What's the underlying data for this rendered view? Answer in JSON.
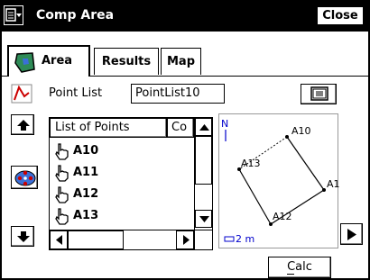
{
  "window": {
    "title": "Comp Area",
    "close_label": "Close"
  },
  "tabs": [
    {
      "label": "Area",
      "active": true
    },
    {
      "label": "Results",
      "active": false
    },
    {
      "label": "Map",
      "active": false
    }
  ],
  "point_list": {
    "label": "Point List",
    "value": "PointList10"
  },
  "list": {
    "columns": [
      "List of Points",
      "Co"
    ],
    "rows": [
      "A10",
      "A11",
      "A12",
      "A13"
    ]
  },
  "map": {
    "north_label": "N",
    "points": [
      "A10",
      "A13",
      "A12",
      "A1"
    ],
    "scale_label": "2 m"
  },
  "calc_label": "Calc",
  "colors": {
    "accent": "#000000",
    "map_blue": "#0000cc",
    "icon_green": "#2e8b57",
    "icon_red": "#cc0000"
  }
}
